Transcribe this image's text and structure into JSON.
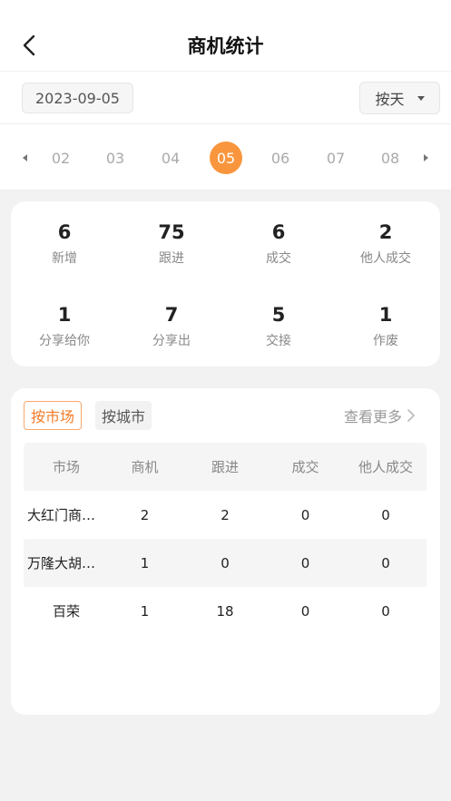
{
  "header": {
    "title": "商机统计"
  },
  "filter": {
    "date": "2023-09-05",
    "mode": "按天"
  },
  "days": [
    {
      "label": "02",
      "active": false
    },
    {
      "label": "03",
      "active": false
    },
    {
      "label": "04",
      "active": false
    },
    {
      "label": "05",
      "active": true
    },
    {
      "label": "06",
      "active": false
    },
    {
      "label": "07",
      "active": false
    },
    {
      "label": "08",
      "active": false
    }
  ],
  "stats": [
    {
      "value": "6",
      "label": "新增"
    },
    {
      "value": "75",
      "label": "跟进"
    },
    {
      "value": "6",
      "label": "成交"
    },
    {
      "value": "2",
      "label": "他人成交"
    },
    {
      "value": "1",
      "label": "分享给你"
    },
    {
      "value": "7",
      "label": "分享出"
    },
    {
      "value": "5",
      "label": "交接"
    },
    {
      "value": "1",
      "label": "作废"
    }
  ],
  "market": {
    "tab_market": "按市场",
    "tab_city": "按城市",
    "more": "查看更多",
    "columns": [
      "市场",
      "商机",
      "跟进",
      "成交",
      "他人成交"
    ],
    "rows": [
      [
        "大红门商贸城",
        "2",
        "2",
        "0",
        "0"
      ],
      [
        "万隆大胡同市场",
        "1",
        "0",
        "0",
        "0"
      ],
      [
        "百荣",
        "1",
        "18",
        "0",
        "0"
      ]
    ]
  },
  "icons": {
    "back": "chevron-left-icon",
    "more": "chevron-right-icon",
    "mode": "caret-down-icon"
  },
  "colors": {
    "accent": "#f9963d",
    "accent_text": "#f27c2a"
  }
}
